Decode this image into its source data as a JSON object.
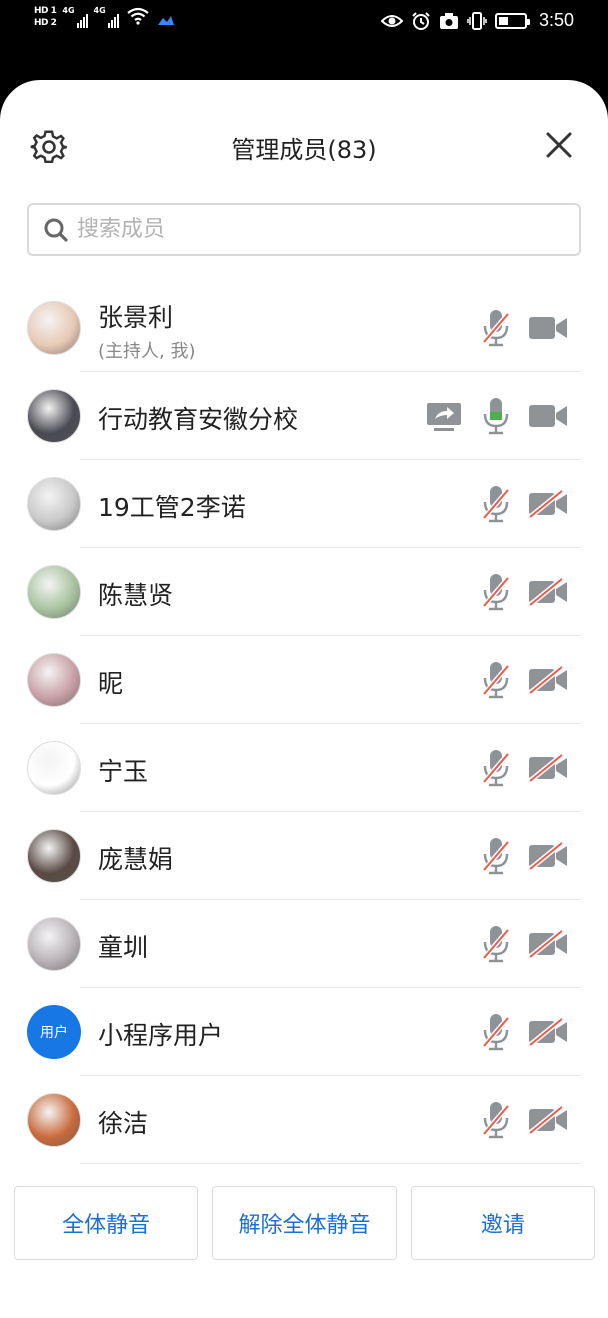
{
  "status_bar": {
    "sim1": "HD 1",
    "sim2": "HD 2",
    "network1": "4G",
    "network2": "4G",
    "time": "3:50"
  },
  "header": {
    "title": "管理成员(83)",
    "settings_icon": "gear-icon",
    "close_icon": "close-icon"
  },
  "search": {
    "placeholder": "搜索成员"
  },
  "members": [
    {
      "name": "张景利",
      "sub": "(主持人, 我)",
      "avatar_color": "#e8c9b5",
      "mic": "muted",
      "cam": "on",
      "sharing": false
    },
    {
      "name": "行动教育安徽分校",
      "avatar_color": "#4a4a52",
      "mic": "on",
      "cam": "on",
      "sharing": true
    },
    {
      "name": "19工管2李诺",
      "avatar_color": "#c9c9c9",
      "mic": "muted",
      "cam": "off",
      "sharing": false
    },
    {
      "name": "陈慧贤",
      "avatar_color": "#a9c4a0",
      "mic": "muted",
      "cam": "off",
      "sharing": false
    },
    {
      "name": "昵",
      "avatar_color": "#c9a1a6",
      "mic": "muted",
      "cam": "off",
      "sharing": false
    },
    {
      "name": "宁玉",
      "avatar_color": "#ffffff",
      "mic": "muted",
      "cam": "off",
      "sharing": false
    },
    {
      "name": "庞慧娟",
      "avatar_color": "#5a4a44",
      "mic": "muted",
      "cam": "off",
      "sharing": false
    },
    {
      "name": "童圳",
      "avatar_color": "#b9b3b8",
      "mic": "muted",
      "cam": "off",
      "sharing": false
    },
    {
      "name": "小程序用户",
      "avatar_text": "用户",
      "avatar_color": "#1677e5",
      "mic": "muted",
      "cam": "off",
      "sharing": false
    },
    {
      "name": "徐洁",
      "avatar_color": "#c96a3c",
      "mic": "muted",
      "cam": "off",
      "sharing": false
    }
  ],
  "actions": {
    "mute_all": "全体静音",
    "unmute_all": "解除全体静音",
    "invite": "邀请"
  },
  "colors": {
    "accent": "#1b6fd6",
    "mic_on": "#4caf50",
    "muted_slash": "#e55b4b",
    "icon_gray": "#8f9398"
  }
}
